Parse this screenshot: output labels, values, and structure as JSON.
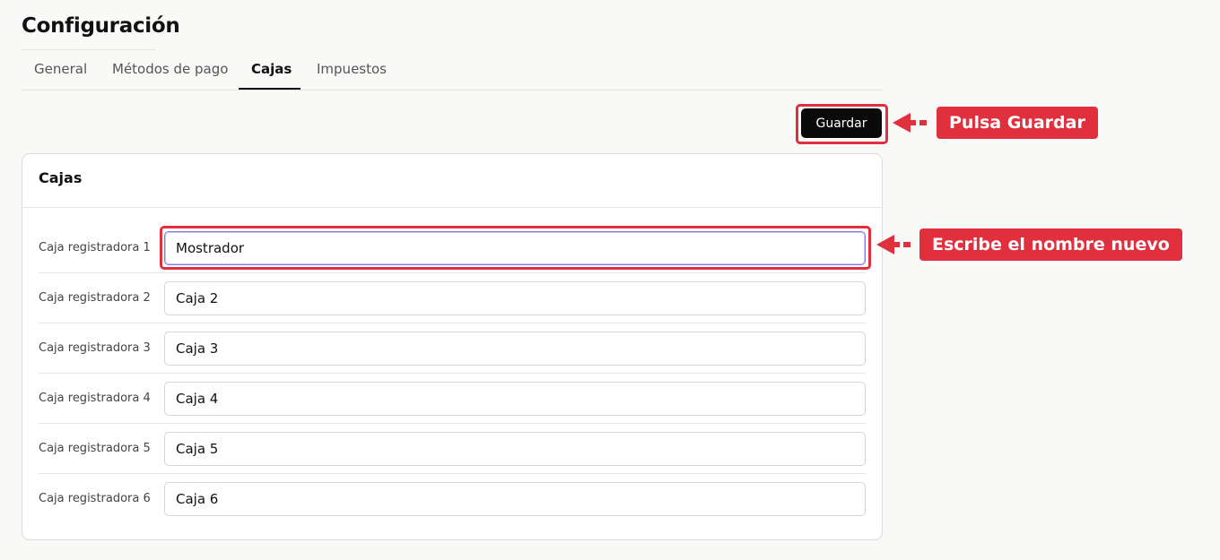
{
  "page": {
    "title": "Configuración"
  },
  "tabs": [
    {
      "label": "General"
    },
    {
      "label": "Métodos de pago"
    },
    {
      "label": "Cajas"
    },
    {
      "label": "Impuestos"
    }
  ],
  "active_tab": "Cajas",
  "toolbar": {
    "save_label": "Guardar"
  },
  "card": {
    "title": "Cajas",
    "rows": [
      {
        "label": "Caja registradora 1",
        "value": "Mostrador"
      },
      {
        "label": "Caja registradora 2",
        "value": "Caja 2"
      },
      {
        "label": "Caja registradora 3",
        "value": "Caja 3"
      },
      {
        "label": "Caja registradora 4",
        "value": "Caja 4"
      },
      {
        "label": "Caja registradora 5",
        "value": "Caja 5"
      },
      {
        "label": "Caja registradora 6",
        "value": "Caja 6"
      }
    ]
  },
  "annotations": {
    "save": "Pulsa Guardar",
    "rename": "Escribe el nombre nuevo"
  },
  "colors": {
    "accent": "#e0303e",
    "primary_button": "#0a0a0a",
    "focus_ring": "#7b7be6"
  }
}
